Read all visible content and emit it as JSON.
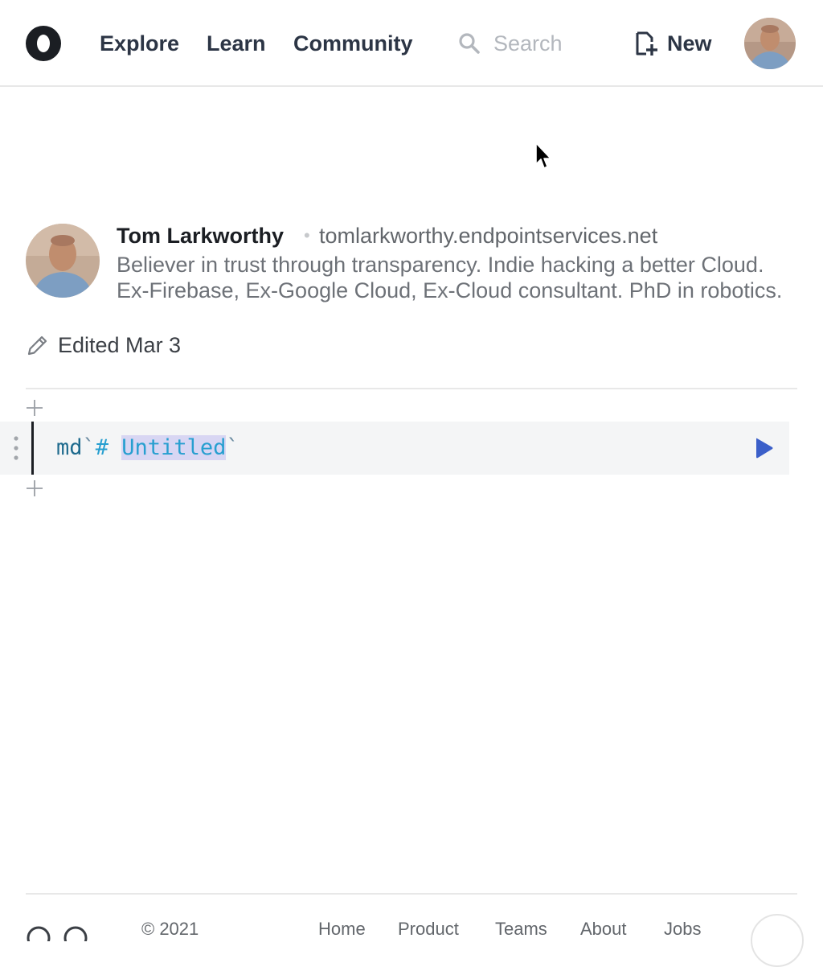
{
  "header": {
    "nav": [
      "Explore",
      "Learn",
      "Community"
    ],
    "search_placeholder": "Search",
    "new_label": "New"
  },
  "author": {
    "name": "Tom Larkworthy",
    "url": "tomlarkworthy.endpointservices.net",
    "bio": "Believer in trust through transparency. Indie hacking a better Cloud. Ex-Firebase, Ex-Google Cloud, Ex-Cloud consultant. PhD in robotics."
  },
  "notebook": {
    "edited": "Edited Mar 3",
    "cell": {
      "fn": "md",
      "tick_open": "`",
      "hash": "# ",
      "title": "Untitled",
      "tick_close": "`"
    }
  },
  "footer": {
    "copyright": "© 2021",
    "links": [
      "Home",
      "Product",
      "Teams",
      "About",
      "Jobs"
    ]
  },
  "colors": {
    "accent": "#3b5fc9",
    "nav_text": "#2c3545",
    "cell_bg": "#f4f5f6",
    "selection": "#d8d6f3"
  }
}
